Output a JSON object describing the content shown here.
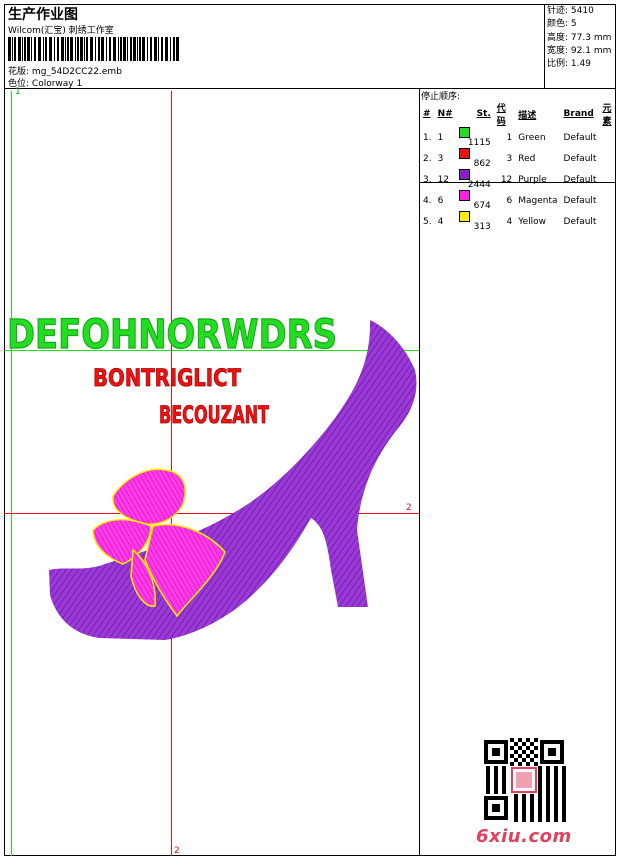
{
  "header": {
    "title": "生产作业图",
    "brand": "Wilcom(汇宝) 刺绣工作室",
    "design_label": "花版:",
    "design_file": "mg_54D2CC22.emb",
    "colorway_label": "色位:",
    "colorway": "Colorway 1"
  },
  "specs": [
    {
      "label": "针迹:",
      "value": "5410"
    },
    {
      "label": "颜色:",
      "value": "5"
    },
    {
      "label": "高度:",
      "value": "77.3 mm"
    },
    {
      "label": "宽度:",
      "value": "92.1 mm"
    },
    {
      "label": "比例:",
      "value": "1.49"
    }
  ],
  "stop_sequence": {
    "title": "停止顺序:",
    "headers": [
      "#",
      "N#",
      "St.",
      "代码",
      "描述",
      "Brand",
      "元素"
    ],
    "rows": [
      {
        "num": "1.",
        "n": "1",
        "st": "1115",
        "code": "1",
        "desc": "Green",
        "brand": "Default",
        "color": "#22dd22"
      },
      {
        "num": "2.",
        "n": "3",
        "st": "862",
        "code": "3",
        "desc": "Red",
        "brand": "Default",
        "color": "#ee1111"
      },
      {
        "num": "3.",
        "n": "12",
        "st": "2444",
        "code": "12",
        "desc": "Purple",
        "brand": "Default",
        "color": "#8a1fc8"
      },
      {
        "num": "4.",
        "n": "6",
        "st": "674",
        "code": "6",
        "desc": "Magenta",
        "brand": "Default",
        "color": "#ff1fe0"
      },
      {
        "num": "5.",
        "n": "4",
        "st": "313",
        "code": "4",
        "desc": "Yellow",
        "brand": "Default",
        "color": "#ffee00"
      }
    ]
  },
  "canvas": {
    "corner_label": "1",
    "guide_label_right": "2",
    "guide_label_bottom": "2",
    "design_text_1": "DEFOHNORWDRS",
    "design_text_2": "BONTRIGLICT",
    "design_text_3": "BECOUZANT"
  },
  "footer": {
    "site": "6xiu.com"
  },
  "colors": {
    "green": "#22dd22",
    "red": "#ee1111",
    "purple": "#8a1fc8",
    "magenta": "#ff1fe0",
    "yellow": "#ffee00"
  }
}
